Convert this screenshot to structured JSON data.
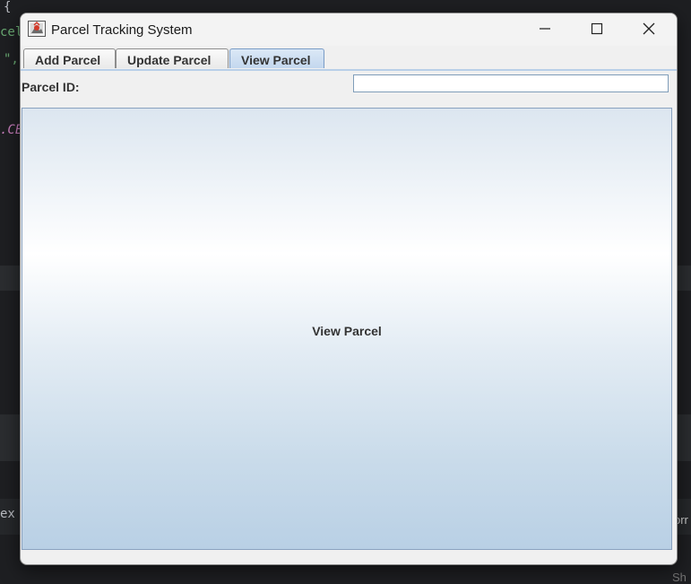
{
  "background": {
    "code_line_1": "{",
    "code_line_2": "cel",
    "code_line_3": "\",",
    "code_line_4": ".CE",
    "code_line_5": "ex",
    "right_text_1": "orr",
    "right_text_2": "Sh"
  },
  "window": {
    "title": "Parcel Tracking System",
    "icons": [
      "app-icon",
      "minimize-icon",
      "maximize-icon",
      "close-icon"
    ]
  },
  "tabs": [
    {
      "label": "Add Parcel",
      "active": false
    },
    {
      "label": "Update Parcel",
      "active": false
    },
    {
      "label": "View Parcel",
      "active": true
    }
  ],
  "form": {
    "parcel_id_label": "Parcel ID:",
    "parcel_id_value": ""
  },
  "panel": {
    "text": "View Parcel"
  },
  "colors": {
    "active_tab": "#c3d7ee",
    "panel_top": "#dce6f0",
    "panel_bottom": "#b9d0e5",
    "editor_bg": "#1e1f22"
  }
}
